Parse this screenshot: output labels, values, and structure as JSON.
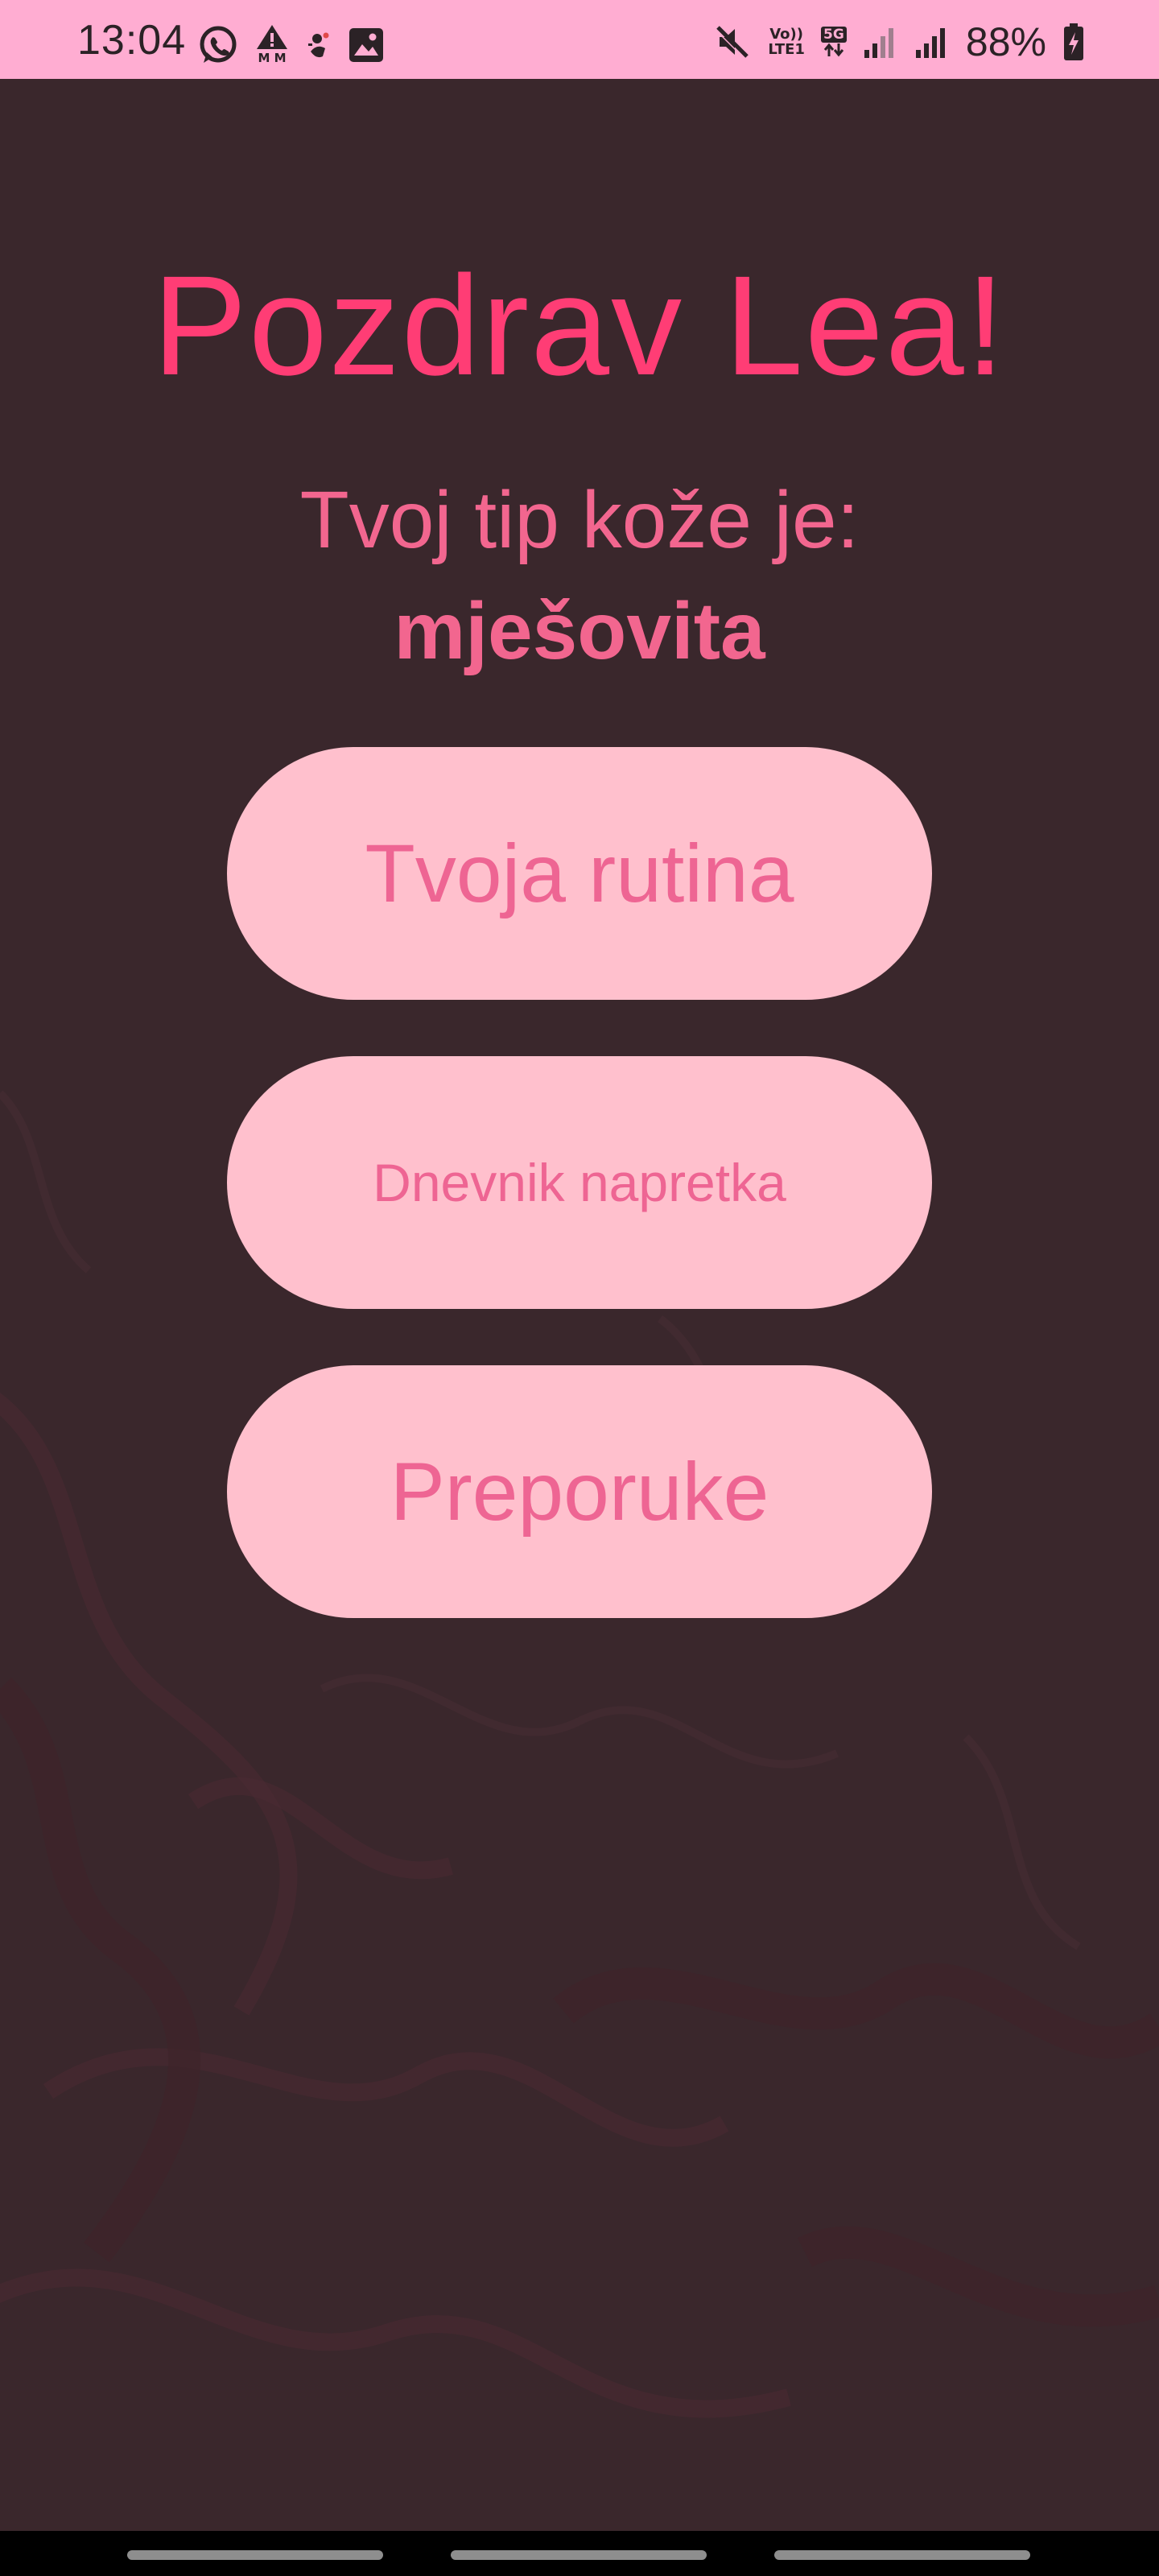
{
  "status_bar": {
    "time": "13:04",
    "left_icons": [
      "whatsapp-icon",
      "drive-mode-warning-icon",
      "app-notification-icon",
      "gallery-icon"
    ],
    "warning_caption": "M M",
    "volte_label": "Vo))",
    "lte_label": "LTE1",
    "fiveg_label": "5G",
    "battery_percent": "88%",
    "signal_strength": [
      0.5,
      1.0
    ]
  },
  "main": {
    "greeting": "Pozdrav Lea!",
    "skin_type_label": "Tvoj tip kože je:",
    "skin_type_value": "mješovita",
    "buttons": [
      {
        "label": "Tvoja rutina"
      },
      {
        "label": "Dnevnik napretka"
      },
      {
        "label": "Preporuke"
      }
    ]
  },
  "colors": {
    "status_bar_bg": "#ffadd2",
    "background": "#3a272c",
    "greeting": "#ff3d75",
    "skin_text": "#f2668f",
    "button_bg": "#ffc0cd",
    "button_text": "#ee6593"
  }
}
